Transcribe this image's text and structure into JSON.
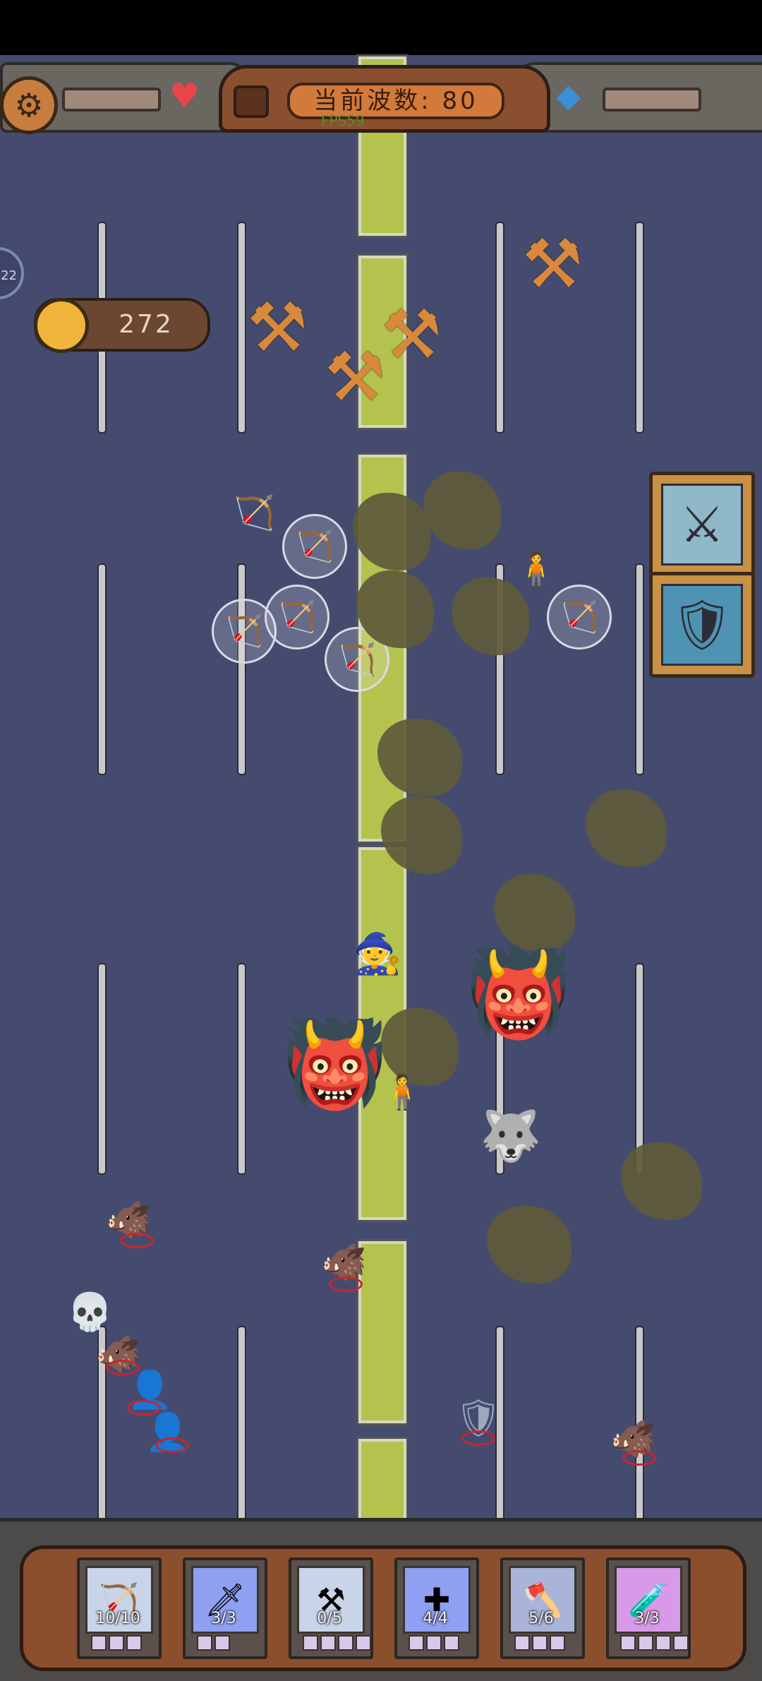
{
  "hud": {
    "wave_label": "当前波数:",
    "wave_number": "80",
    "fps": "FPS59",
    "gold": "272",
    "side_counter": "22",
    "icons": {
      "settings": "gear-icon",
      "health": "heart-icon",
      "gem": "blue-gem-icon",
      "coin": "gold-coin-icon"
    }
  },
  "skills": [
    {
      "name": "catapult-upgrade-skill",
      "icon": "weapons-rack-icon"
    },
    {
      "name": "sword-shield-skill",
      "icon": "sword-shield-icon"
    }
  ],
  "units": [
    {
      "name": "archer",
      "count": "10/10",
      "icon": "archer-icon"
    },
    {
      "name": "swordsman",
      "count": "3/3",
      "icon": "swordsman-icon"
    },
    {
      "name": "catapult",
      "count": "0/5",
      "icon": "catapult-icon"
    },
    {
      "name": "priest",
      "count": "4/4",
      "icon": "priest-icon"
    },
    {
      "name": "warrior",
      "count": "5/6",
      "icon": "warrior-icon"
    },
    {
      "name": "mage",
      "count": "3/3",
      "icon": "mage-icon"
    }
  ],
  "colors": {
    "field": "#454b6f",
    "path": "#b4c24e",
    "wood": "#8b4f2e",
    "gold": "#f0b53a"
  }
}
